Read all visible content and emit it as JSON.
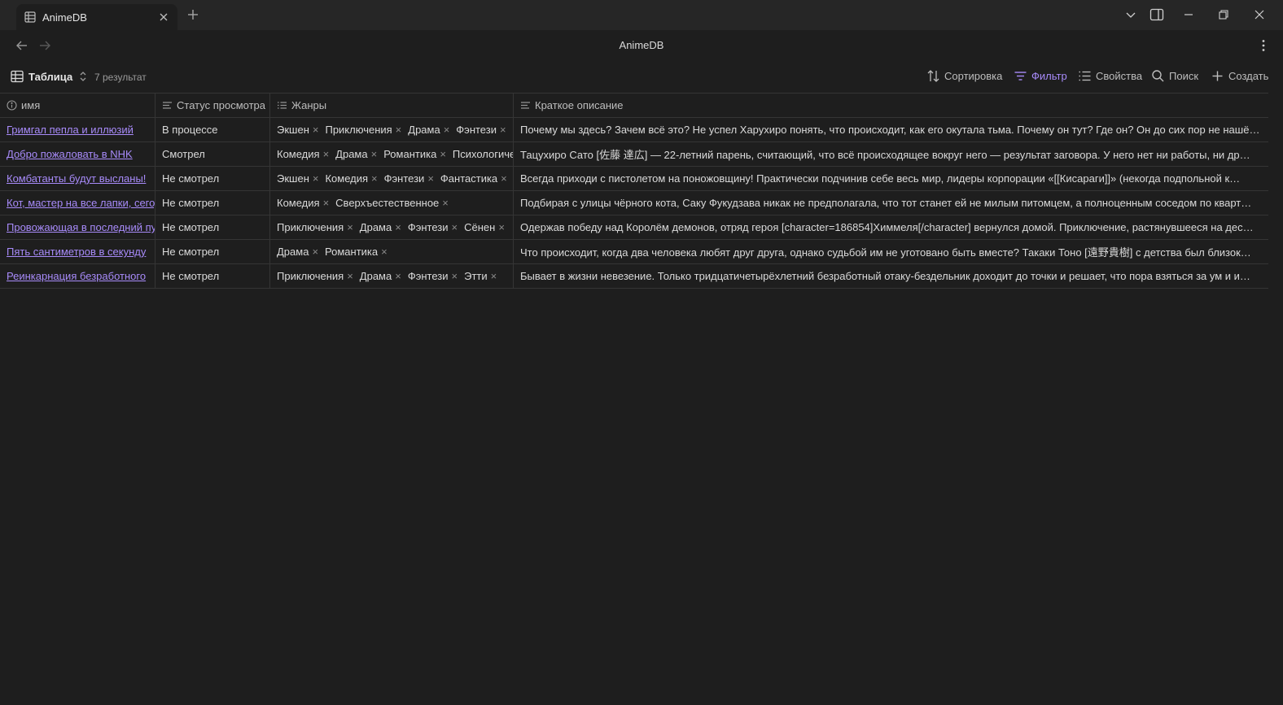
{
  "tab": {
    "label": "AnimeDB"
  },
  "nav": {
    "title": "AnimeDB"
  },
  "toolbar": {
    "view_label": "Таблица",
    "results": "7 результат",
    "sort": "Сортировка",
    "filter": "Фильтр",
    "properties": "Свойства",
    "search": "Поиск",
    "create": "Создать"
  },
  "colors": {
    "accent": "#a88bfa",
    "background": "#1e1e1e",
    "titlebar": "#262626"
  },
  "table": {
    "headers": {
      "name": "имя",
      "status": "Статус просмотра",
      "genres": "Жанры",
      "description": "Краткое описание"
    },
    "rows": [
      {
        "name": "Гримгал пепла и иллюзий",
        "status": "В процессе",
        "genres": [
          "Экшен",
          "Приключения",
          "Драма",
          "Фэнтези"
        ],
        "description": "Почему мы здесь? Зачем всё это? Не успел Харухиро понять, что происходит, как его окутала тьма. Почему он тут? Где он? Он до сих пор не нашё…"
      },
      {
        "name": "Добро пожаловать в NHK",
        "status": "Смотрел",
        "genres": [
          "Комедия",
          "Драма",
          "Романтика",
          "Психологическое"
        ],
        "description": "Тацухиро Сато [佐藤 達広] — 22-летний парень, считающий, что всё происходящее вокруг него — результат заговора. У него нет ни работы, ни др…"
      },
      {
        "name": "Комбатанты будут высланы!",
        "status": "Не смотрел",
        "genres": [
          "Экшен",
          "Комедия",
          "Фэнтези",
          "Фантастика"
        ],
        "description": "Всегда приходи с пистолетом на поножовщину! Практически подчинив себе весь мир, лидеры корпорации «[[Кисараги]]» (некогда подпольной к…"
      },
      {
        "name": "Кот, мастер на все лапки, сегодня",
        "status": "Не смотрел",
        "genres": [
          "Комедия",
          "Сверхъестественное"
        ],
        "description": "Подбирая с улицы чёрного кота, Саку Фукудзава никак не предполагала, что тот станет ей не милым питомцем, а полноценным соседом по кварт…"
      },
      {
        "name": "Провожающая в последний путь Фрирен",
        "status": "Не смотрел",
        "genres": [
          "Приключения",
          "Драма",
          "Фэнтези",
          "Сёнен"
        ],
        "description": "Одержав победу над Королём демонов, отряд героя [character=186854]Химмеля[/character] вернулся домой. Приключение, растянувшееся на дес…"
      },
      {
        "name": "Пять сантиметров в секунду",
        "status": "Не смотрел",
        "genres": [
          "Драма",
          "Романтика"
        ],
        "description": "Что происходит, когда два человека любят друг друга, однако судьбой им не уготовано быть вместе? Такаки Тоно [遠野貴樹] с детства был близок…"
      },
      {
        "name": "Реинкарнация безработного",
        "status": "Не смотрел",
        "genres": [
          "Приключения",
          "Драма",
          "Фэнтези",
          "Этти"
        ],
        "description": "Бывает в жизни невезение. Только тридцатичетырёхлетний безработный отаку-бездельник доходит до точки и решает, что пора взяться за ум и и…"
      }
    ]
  }
}
